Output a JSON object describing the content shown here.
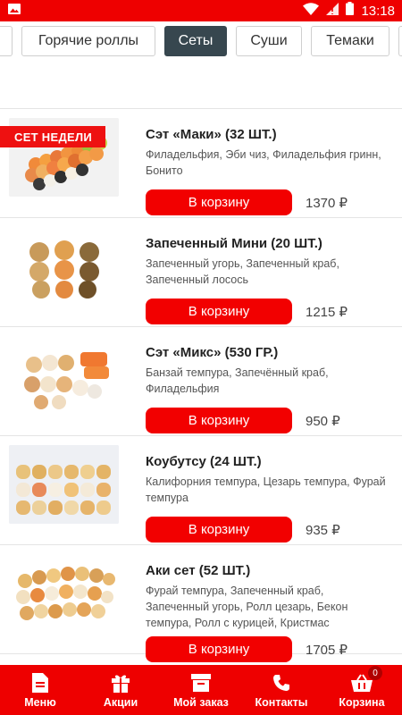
{
  "status_bar": {
    "time": "13:18",
    "icons": [
      "image-icon",
      "wifi-icon",
      "signal-icon",
      "battery-icon"
    ]
  },
  "tabs": [
    {
      "label": "",
      "partial": "left"
    },
    {
      "label": "Горячие роллы",
      "active": false
    },
    {
      "label": "Сеты",
      "active": true
    },
    {
      "label": "Суши",
      "active": false
    },
    {
      "label": "Темаки",
      "active": false
    },
    {
      "label": "",
      "partial": "right"
    }
  ],
  "badge": "СЕТ НЕДЕЛИ",
  "products": [
    {
      "name": "Сэт «Маки» (32 ШТ.)",
      "description": "Филадельфия, Эби чиз, Филадельфия гринн, Бонито",
      "button": "В корзину",
      "price": "1370 ₽"
    },
    {
      "name": "Запеченный Мини (20 ШТ.)",
      "description": "Запеченный угорь, Запеченный краб, Запеченный лосось",
      "button": "В корзину",
      "price": "1215 ₽"
    },
    {
      "name": "Сэт «Микс» (530 ГР.)",
      "description": "Банзай темпура, Запечённый краб, Филадельфия",
      "button": "В корзину",
      "price": "950 ₽"
    },
    {
      "name": "Коубутсу (24 ШТ.)",
      "description": "Калифорния темпура, Цезарь темпура, Фурай темпура",
      "button": "В корзину",
      "price": "935 ₽"
    },
    {
      "name": "Аки сет (52 ШТ.)",
      "description": "Фурай темпура, Запеченный краб, Запеченный угорь, Ролл цезарь, Бекон темпура, Ролл с курицей, Кристмас",
      "button": "В корзину",
      "price": "1705 ₽"
    }
  ],
  "bottom_nav": [
    {
      "label": "Меню",
      "icon": "document-icon"
    },
    {
      "label": "Акции",
      "icon": "gift-icon"
    },
    {
      "label": "Мой заказ",
      "icon": "archive-icon"
    },
    {
      "label": "Контакты",
      "icon": "phone-icon"
    },
    {
      "label": "Корзина",
      "icon": "basket-icon",
      "count": "0"
    }
  ],
  "colors": {
    "brand_red": "#ee0000",
    "active_tab": "#37474f",
    "button_red": "#f20000"
  }
}
